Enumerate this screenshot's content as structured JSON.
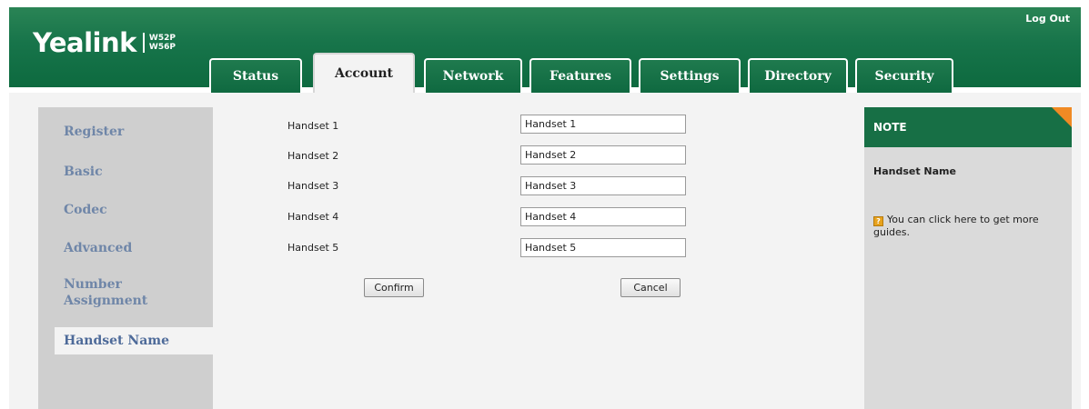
{
  "header": {
    "brand": "Yealink",
    "models": [
      "W52P",
      "W56P"
    ],
    "logout": "Log Out"
  },
  "tabs": [
    {
      "label": "Status"
    },
    {
      "label": "Account",
      "active": true
    },
    {
      "label": "Network"
    },
    {
      "label": "Features"
    },
    {
      "label": "Settings"
    },
    {
      "label": "Directory"
    },
    {
      "label": "Security"
    }
  ],
  "sidebar": {
    "items": [
      {
        "label": "Register"
      },
      {
        "label": "Basic"
      },
      {
        "label": "Codec"
      },
      {
        "label": "Advanced"
      },
      {
        "label": "Number Assignment"
      },
      {
        "label": "Handset Name",
        "active": true
      }
    ]
  },
  "form": {
    "rows": [
      {
        "label": "Handset 1",
        "value": "Handset 1"
      },
      {
        "label": "Handset 2",
        "value": "Handset 2"
      },
      {
        "label": "Handset 3",
        "value": "Handset 3"
      },
      {
        "label": "Handset 4",
        "value": "Handset 4"
      },
      {
        "label": "Handset 5",
        "value": "Handset 5"
      }
    ],
    "confirm": "Confirm",
    "cancel": "Cancel"
  },
  "note": {
    "heading": "NOTE",
    "title": "Handset Name",
    "text": "You can click here to get more guides."
  },
  "colors": {
    "header_green": "#17744a",
    "accent_orange": "#f08a24",
    "sidebar_link": "#6f86a8"
  }
}
